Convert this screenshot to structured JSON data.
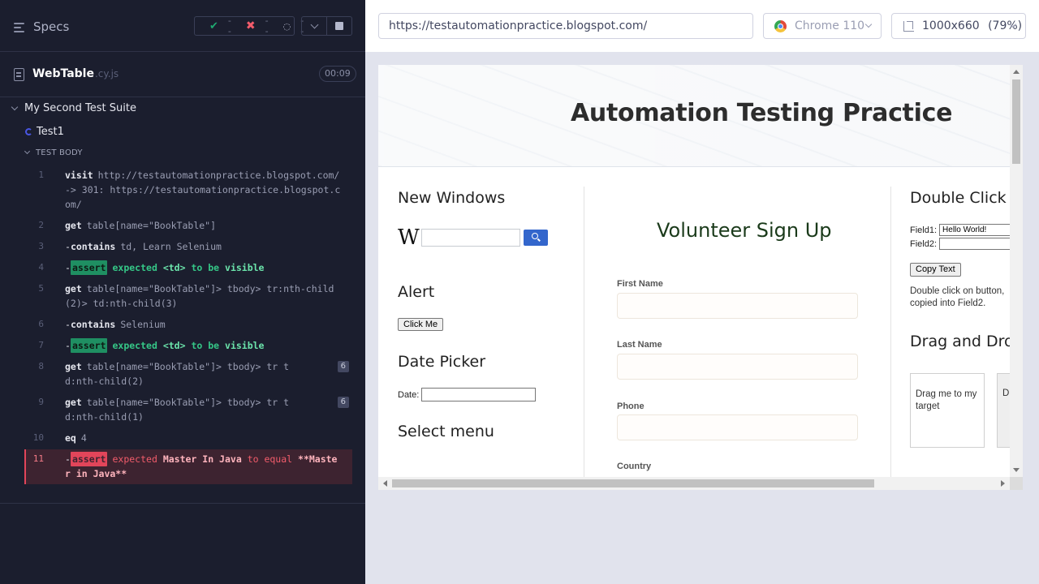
{
  "reporter": {
    "specs_label": "Specs",
    "stats": {
      "passed": "--",
      "failed": "--",
      "pending": "--"
    },
    "spec": {
      "name": "WebTable",
      "ext": ".cy.js",
      "duration": "00:09"
    },
    "suite_title": "My Second Test Suite",
    "test_title": "Test1",
    "body_label": "TEST BODY",
    "commands": [
      {
        "num": "1",
        "name": "visit",
        "message": "http://testautomationpractice.blogspot.com/ -> 301: https://testautomationpractice.blogspot.com/"
      },
      {
        "num": "2",
        "name": "get",
        "message": "table[name=\"BookTable\"]"
      },
      {
        "num": "3",
        "prefix": "-",
        "name": "contains",
        "message": "td, Learn Selenium"
      },
      {
        "num": "4",
        "prefix": "-",
        "assert": "assert",
        "expected": "expected",
        "subject": "<td>",
        "mid": "to be",
        "value": "visible"
      },
      {
        "num": "5",
        "name": "get",
        "message": "table[name=\"BookTable\"]> tbody> tr:nth-child(2)> td:nth-child(3)"
      },
      {
        "num": "6",
        "prefix": "-",
        "name": "contains",
        "message": "Selenium"
      },
      {
        "num": "7",
        "prefix": "-",
        "assert": "assert",
        "expected": "expected",
        "subject": "<td>",
        "mid": "to be",
        "value": "visible"
      },
      {
        "num": "8",
        "name": "get",
        "message": "table[name=\"BookTable\"]> tbody> tr td:nth-child(2)",
        "badge": "6"
      },
      {
        "num": "9",
        "name": "get",
        "message": "table[name=\"BookTable\"]> tbody> tr td:nth-child(1)",
        "badge": "6"
      },
      {
        "num": "10",
        "name": "eq",
        "message": "4"
      },
      {
        "num": "11",
        "prefix": "-",
        "assert": "assert",
        "expected": "expected",
        "subject": "Master In Java",
        "mid": "to equal",
        "value": "**Master in Java**"
      }
    ]
  },
  "aut": {
    "url": "https://testautomationpractice.blogspot.com/",
    "browser": "Chrome 110",
    "viewport": "1000x660",
    "zoom": "(79%)",
    "page": {
      "banner_title": "Automation Testing Practice",
      "new_windows": "New Windows",
      "wiki_logo": "W",
      "alert": "Alert",
      "click_me": "Click Me",
      "date_picker": "Date Picker",
      "date_label": "Date:",
      "select_menu": "Select menu",
      "volunteer_title": "Volunteer Sign Up",
      "first_name": "First Name",
      "last_name": "Last Name",
      "phone": "Phone",
      "country": "Country",
      "double_click": "Double Click",
      "field1_label": "Field1:",
      "field1_value": "Hello World!",
      "field2_label": "Field2:",
      "copy_text": "Copy Text",
      "dbl_desc": "Double click on button, copied into Field2.",
      "drag_drop": "Drag and Drop",
      "drag_text": "Drag me to my target",
      "drop_text": "D"
    }
  },
  "colors": {
    "reporter_bg": "#1b1e2e",
    "pass": "#1fa971",
    "fail": "#e2455a",
    "accent": "#4956e3"
  }
}
